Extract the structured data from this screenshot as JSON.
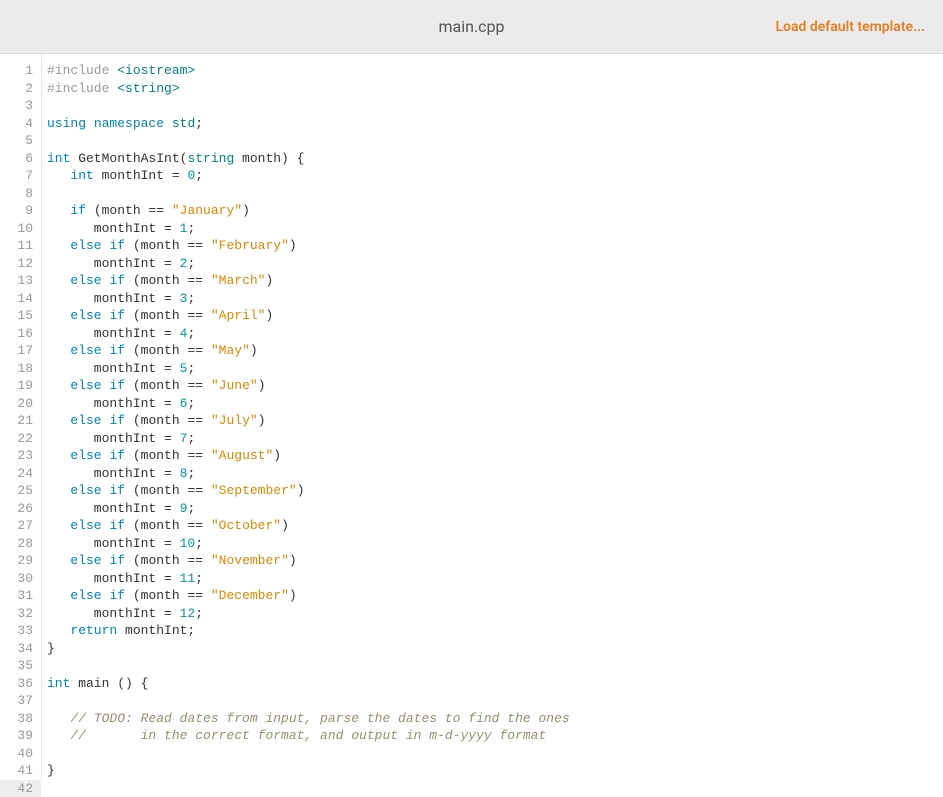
{
  "header": {
    "filename": "main.cpp",
    "load_template": "Load default template..."
  },
  "editor": {
    "active_line": 42,
    "lines": [
      {
        "n": 1,
        "tokens": [
          {
            "c": "inc-dir",
            "t": "#include "
          },
          {
            "c": "incb",
            "t": "<iostream>"
          }
        ]
      },
      {
        "n": 2,
        "tokens": [
          {
            "c": "inc-dir",
            "t": "#include "
          },
          {
            "c": "incb",
            "t": "<string>"
          }
        ]
      },
      {
        "n": 3,
        "tokens": []
      },
      {
        "n": 4,
        "tokens": [
          {
            "c": "kw",
            "t": "using"
          },
          {
            "c": "pln",
            "t": " "
          },
          {
            "c": "kw",
            "t": "namespace"
          },
          {
            "c": "pln",
            "t": " "
          },
          {
            "c": "type",
            "t": "std"
          },
          {
            "c": "pln",
            "t": ";"
          }
        ]
      },
      {
        "n": 5,
        "tokens": []
      },
      {
        "n": 6,
        "tokens": [
          {
            "c": "kw",
            "t": "int"
          },
          {
            "c": "pln",
            "t": " GetMonthAsInt("
          },
          {
            "c": "type",
            "t": "string"
          },
          {
            "c": "pln",
            "t": " month) {"
          }
        ]
      },
      {
        "n": 7,
        "tokens": [
          {
            "c": "pln",
            "t": "   "
          },
          {
            "c": "kw",
            "t": "int"
          },
          {
            "c": "pln",
            "t": " monthInt = "
          },
          {
            "c": "num",
            "t": "0"
          },
          {
            "c": "pln",
            "t": ";"
          }
        ]
      },
      {
        "n": 8,
        "tokens": [
          {
            "c": "pln",
            "t": "   "
          }
        ]
      },
      {
        "n": 9,
        "tokens": [
          {
            "c": "pln",
            "t": "   "
          },
          {
            "c": "kw",
            "t": "if"
          },
          {
            "c": "pln",
            "t": " (month == "
          },
          {
            "c": "str",
            "t": "\"January\""
          },
          {
            "c": "pln",
            "t": ")"
          }
        ]
      },
      {
        "n": 10,
        "tokens": [
          {
            "c": "pln",
            "t": "      monthInt = "
          },
          {
            "c": "num",
            "t": "1"
          },
          {
            "c": "pln",
            "t": ";"
          }
        ]
      },
      {
        "n": 11,
        "tokens": [
          {
            "c": "pln",
            "t": "   "
          },
          {
            "c": "kw",
            "t": "else"
          },
          {
            "c": "pln",
            "t": " "
          },
          {
            "c": "kw",
            "t": "if"
          },
          {
            "c": "pln",
            "t": " (month == "
          },
          {
            "c": "str",
            "t": "\"February\""
          },
          {
            "c": "pln",
            "t": ")"
          }
        ]
      },
      {
        "n": 12,
        "tokens": [
          {
            "c": "pln",
            "t": "      monthInt = "
          },
          {
            "c": "num",
            "t": "2"
          },
          {
            "c": "pln",
            "t": ";"
          }
        ]
      },
      {
        "n": 13,
        "tokens": [
          {
            "c": "pln",
            "t": "   "
          },
          {
            "c": "kw",
            "t": "else"
          },
          {
            "c": "pln",
            "t": " "
          },
          {
            "c": "kw",
            "t": "if"
          },
          {
            "c": "pln",
            "t": " (month == "
          },
          {
            "c": "str",
            "t": "\"March\""
          },
          {
            "c": "pln",
            "t": ")"
          }
        ]
      },
      {
        "n": 14,
        "tokens": [
          {
            "c": "pln",
            "t": "      monthInt = "
          },
          {
            "c": "num",
            "t": "3"
          },
          {
            "c": "pln",
            "t": ";"
          }
        ]
      },
      {
        "n": 15,
        "tokens": [
          {
            "c": "pln",
            "t": "   "
          },
          {
            "c": "kw",
            "t": "else"
          },
          {
            "c": "pln",
            "t": " "
          },
          {
            "c": "kw",
            "t": "if"
          },
          {
            "c": "pln",
            "t": " (month == "
          },
          {
            "c": "str",
            "t": "\"April\""
          },
          {
            "c": "pln",
            "t": ")"
          }
        ]
      },
      {
        "n": 16,
        "tokens": [
          {
            "c": "pln",
            "t": "      monthInt = "
          },
          {
            "c": "num",
            "t": "4"
          },
          {
            "c": "pln",
            "t": ";"
          }
        ]
      },
      {
        "n": 17,
        "tokens": [
          {
            "c": "pln",
            "t": "   "
          },
          {
            "c": "kw",
            "t": "else"
          },
          {
            "c": "pln",
            "t": " "
          },
          {
            "c": "kw",
            "t": "if"
          },
          {
            "c": "pln",
            "t": " (month == "
          },
          {
            "c": "str",
            "t": "\"May\""
          },
          {
            "c": "pln",
            "t": ")"
          }
        ]
      },
      {
        "n": 18,
        "tokens": [
          {
            "c": "pln",
            "t": "      monthInt = "
          },
          {
            "c": "num",
            "t": "5"
          },
          {
            "c": "pln",
            "t": ";"
          }
        ]
      },
      {
        "n": 19,
        "tokens": [
          {
            "c": "pln",
            "t": "   "
          },
          {
            "c": "kw",
            "t": "else"
          },
          {
            "c": "pln",
            "t": " "
          },
          {
            "c": "kw",
            "t": "if"
          },
          {
            "c": "pln",
            "t": " (month == "
          },
          {
            "c": "str",
            "t": "\"June\""
          },
          {
            "c": "pln",
            "t": ")"
          }
        ]
      },
      {
        "n": 20,
        "tokens": [
          {
            "c": "pln",
            "t": "      monthInt = "
          },
          {
            "c": "num",
            "t": "6"
          },
          {
            "c": "pln",
            "t": ";"
          }
        ]
      },
      {
        "n": 21,
        "tokens": [
          {
            "c": "pln",
            "t": "   "
          },
          {
            "c": "kw",
            "t": "else"
          },
          {
            "c": "pln",
            "t": " "
          },
          {
            "c": "kw",
            "t": "if"
          },
          {
            "c": "pln",
            "t": " (month == "
          },
          {
            "c": "str",
            "t": "\"July\""
          },
          {
            "c": "pln",
            "t": ")"
          }
        ]
      },
      {
        "n": 22,
        "tokens": [
          {
            "c": "pln",
            "t": "      monthInt = "
          },
          {
            "c": "num",
            "t": "7"
          },
          {
            "c": "pln",
            "t": ";"
          }
        ]
      },
      {
        "n": 23,
        "tokens": [
          {
            "c": "pln",
            "t": "   "
          },
          {
            "c": "kw",
            "t": "else"
          },
          {
            "c": "pln",
            "t": " "
          },
          {
            "c": "kw",
            "t": "if"
          },
          {
            "c": "pln",
            "t": " (month == "
          },
          {
            "c": "str",
            "t": "\"August\""
          },
          {
            "c": "pln",
            "t": ")"
          }
        ]
      },
      {
        "n": 24,
        "tokens": [
          {
            "c": "pln",
            "t": "      monthInt = "
          },
          {
            "c": "num",
            "t": "8"
          },
          {
            "c": "pln",
            "t": ";"
          }
        ]
      },
      {
        "n": 25,
        "tokens": [
          {
            "c": "pln",
            "t": "   "
          },
          {
            "c": "kw",
            "t": "else"
          },
          {
            "c": "pln",
            "t": " "
          },
          {
            "c": "kw",
            "t": "if"
          },
          {
            "c": "pln",
            "t": " (month == "
          },
          {
            "c": "str",
            "t": "\"September\""
          },
          {
            "c": "pln",
            "t": ")"
          }
        ]
      },
      {
        "n": 26,
        "tokens": [
          {
            "c": "pln",
            "t": "      monthInt = "
          },
          {
            "c": "num",
            "t": "9"
          },
          {
            "c": "pln",
            "t": ";"
          }
        ]
      },
      {
        "n": 27,
        "tokens": [
          {
            "c": "pln",
            "t": "   "
          },
          {
            "c": "kw",
            "t": "else"
          },
          {
            "c": "pln",
            "t": " "
          },
          {
            "c": "kw",
            "t": "if"
          },
          {
            "c": "pln",
            "t": " (month == "
          },
          {
            "c": "str",
            "t": "\"October\""
          },
          {
            "c": "pln",
            "t": ")"
          }
        ]
      },
      {
        "n": 28,
        "tokens": [
          {
            "c": "pln",
            "t": "      monthInt = "
          },
          {
            "c": "num",
            "t": "10"
          },
          {
            "c": "pln",
            "t": ";"
          }
        ]
      },
      {
        "n": 29,
        "tokens": [
          {
            "c": "pln",
            "t": "   "
          },
          {
            "c": "kw",
            "t": "else"
          },
          {
            "c": "pln",
            "t": " "
          },
          {
            "c": "kw",
            "t": "if"
          },
          {
            "c": "pln",
            "t": " (month == "
          },
          {
            "c": "str",
            "t": "\"November\""
          },
          {
            "c": "pln",
            "t": ")"
          }
        ]
      },
      {
        "n": 30,
        "tokens": [
          {
            "c": "pln",
            "t": "      monthInt = "
          },
          {
            "c": "num",
            "t": "11"
          },
          {
            "c": "pln",
            "t": ";"
          }
        ]
      },
      {
        "n": 31,
        "tokens": [
          {
            "c": "pln",
            "t": "   "
          },
          {
            "c": "kw",
            "t": "else"
          },
          {
            "c": "pln",
            "t": " "
          },
          {
            "c": "kw",
            "t": "if"
          },
          {
            "c": "pln",
            "t": " (month == "
          },
          {
            "c": "str",
            "t": "\"December\""
          },
          {
            "c": "pln",
            "t": ")"
          }
        ]
      },
      {
        "n": 32,
        "tokens": [
          {
            "c": "pln",
            "t": "      monthInt = "
          },
          {
            "c": "num",
            "t": "12"
          },
          {
            "c": "pln",
            "t": ";"
          }
        ]
      },
      {
        "n": 33,
        "tokens": [
          {
            "c": "pln",
            "t": "   "
          },
          {
            "c": "kw",
            "t": "return"
          },
          {
            "c": "pln",
            "t": " monthInt;"
          }
        ]
      },
      {
        "n": 34,
        "tokens": [
          {
            "c": "pln",
            "t": "}"
          }
        ]
      },
      {
        "n": 35,
        "tokens": []
      },
      {
        "n": 36,
        "tokens": [
          {
            "c": "kw",
            "t": "int"
          },
          {
            "c": "pln",
            "t": " main () {"
          }
        ]
      },
      {
        "n": 37,
        "tokens": [
          {
            "c": "pln",
            "t": "   "
          }
        ]
      },
      {
        "n": 38,
        "tokens": [
          {
            "c": "pln",
            "t": "   "
          },
          {
            "c": "cmt",
            "t": "// TODO: Read dates from input, parse the dates to find the ones"
          }
        ]
      },
      {
        "n": 39,
        "tokens": [
          {
            "c": "pln",
            "t": "   "
          },
          {
            "c": "cmt",
            "t": "//       in the correct format, and output in m-d-yyyy format"
          }
        ]
      },
      {
        "n": 40,
        "tokens": []
      },
      {
        "n": 41,
        "tokens": [
          {
            "c": "pln",
            "t": "}"
          }
        ]
      },
      {
        "n": 42,
        "tokens": []
      }
    ]
  }
}
